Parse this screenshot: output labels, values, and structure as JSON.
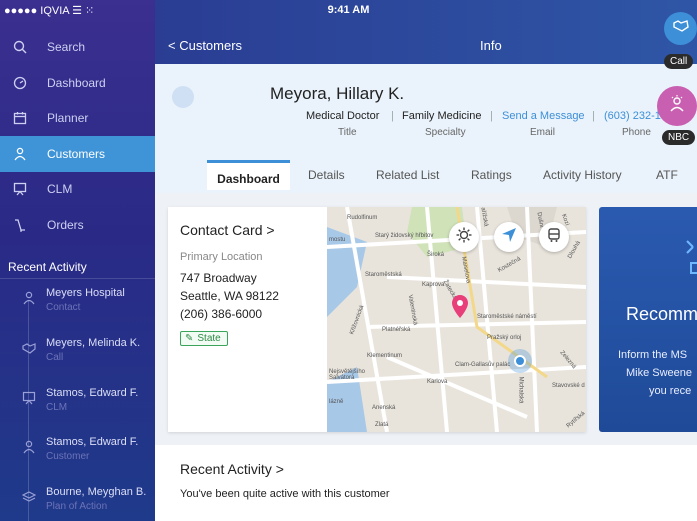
{
  "status_bar": {
    "carrier": "●●●●● IQVIA ☰ ⁙",
    "time": "9:41 AM"
  },
  "sidebar": {
    "items": [
      {
        "label": "Search",
        "icon": "search-icon"
      },
      {
        "label": "Dashboard",
        "icon": "gauge-icon"
      },
      {
        "label": "Planner",
        "icon": "calendar-icon"
      },
      {
        "label": "Customers",
        "icon": "person-icon",
        "active": true
      },
      {
        "label": "CLM",
        "icon": "presentation-icon"
      },
      {
        "label": "Orders",
        "icon": "orders-icon"
      }
    ],
    "recent_heading": "Recent Activity",
    "recent": [
      {
        "name": "Meyers Hospital",
        "sub": "Contact",
        "icon": "person-icon"
      },
      {
        "name": "Meyers, Melinda K.",
        "sub": "Call",
        "icon": "handshake-icon"
      },
      {
        "name": "Stamos, Edward F.",
        "sub": "CLM",
        "icon": "presentation-icon"
      },
      {
        "name": "Stamos, Edward F.",
        "sub": "Customer",
        "icon": "person-icon"
      },
      {
        "name": "Bourne, Meyghan B.",
        "sub": "Plan of Action",
        "icon": "layers-icon"
      }
    ]
  },
  "topnav": {
    "back_label": "< Customers",
    "title": "Info"
  },
  "profile": {
    "name": "Meyora, Hillary K.",
    "title_value": "Medical Doctor",
    "title_label": "Title",
    "specialty_value": "Family Medicine",
    "specialty_label": "Specialty",
    "email_value": "Send a Message",
    "email_label": "Email",
    "phone_value": "(603) 232-1",
    "phone_label": "Phone"
  },
  "tabs": [
    "Dashboard",
    "Details",
    "Related List",
    "Ratings",
    "Activity History",
    "ATF"
  ],
  "contact_card": {
    "title": "Contact Card >",
    "location_label": "Primary Location",
    "address1": "747 Broadway",
    "address2": "Seattle, WA 98122",
    "phone": "(206) 386-6000",
    "badge": "State"
  },
  "map": {
    "labels": [
      "Rudolfinum",
      "Starý židovský hřbitov",
      "Široká",
      "Staroměstská",
      "Kaprova",
      "Platnéřská",
      "Staroměstské náměstí",
      "Pražský orloj",
      "Klementinum",
      "Clam-Gallasův palác",
      "Karlova",
      "Anenská",
      "Zlatá",
      "Michalská",
      "Kozí",
      "Dušní",
      "Valentinská",
      "Křižovnická",
      "Nejsvětějšího Salvátora",
      "Stavovské d",
      "Zelezná",
      "Rytířská",
      "mostu",
      "lázně",
      "Pařížská",
      "Kostečná",
      "Maiselova",
      "Žatecká",
      "Dlouhá"
    ]
  },
  "recommendation": {
    "title": "Recomm",
    "line1": "Inform the MS",
    "line2": "Mike Sweene",
    "line3": "you rece"
  },
  "recent_activity": {
    "title": "Recent Activity  >",
    "description": "You've been quite active with this customer"
  },
  "fabs": {
    "call_label": "Call",
    "nbc_label": "NBC"
  },
  "colors": {
    "accent": "#3d8fd8",
    "sidebar_active": "#3f94d8",
    "call_fab": "#3d8fd8",
    "nbc_fab": "#c95fb0",
    "badge_green": "#3aa55a"
  }
}
